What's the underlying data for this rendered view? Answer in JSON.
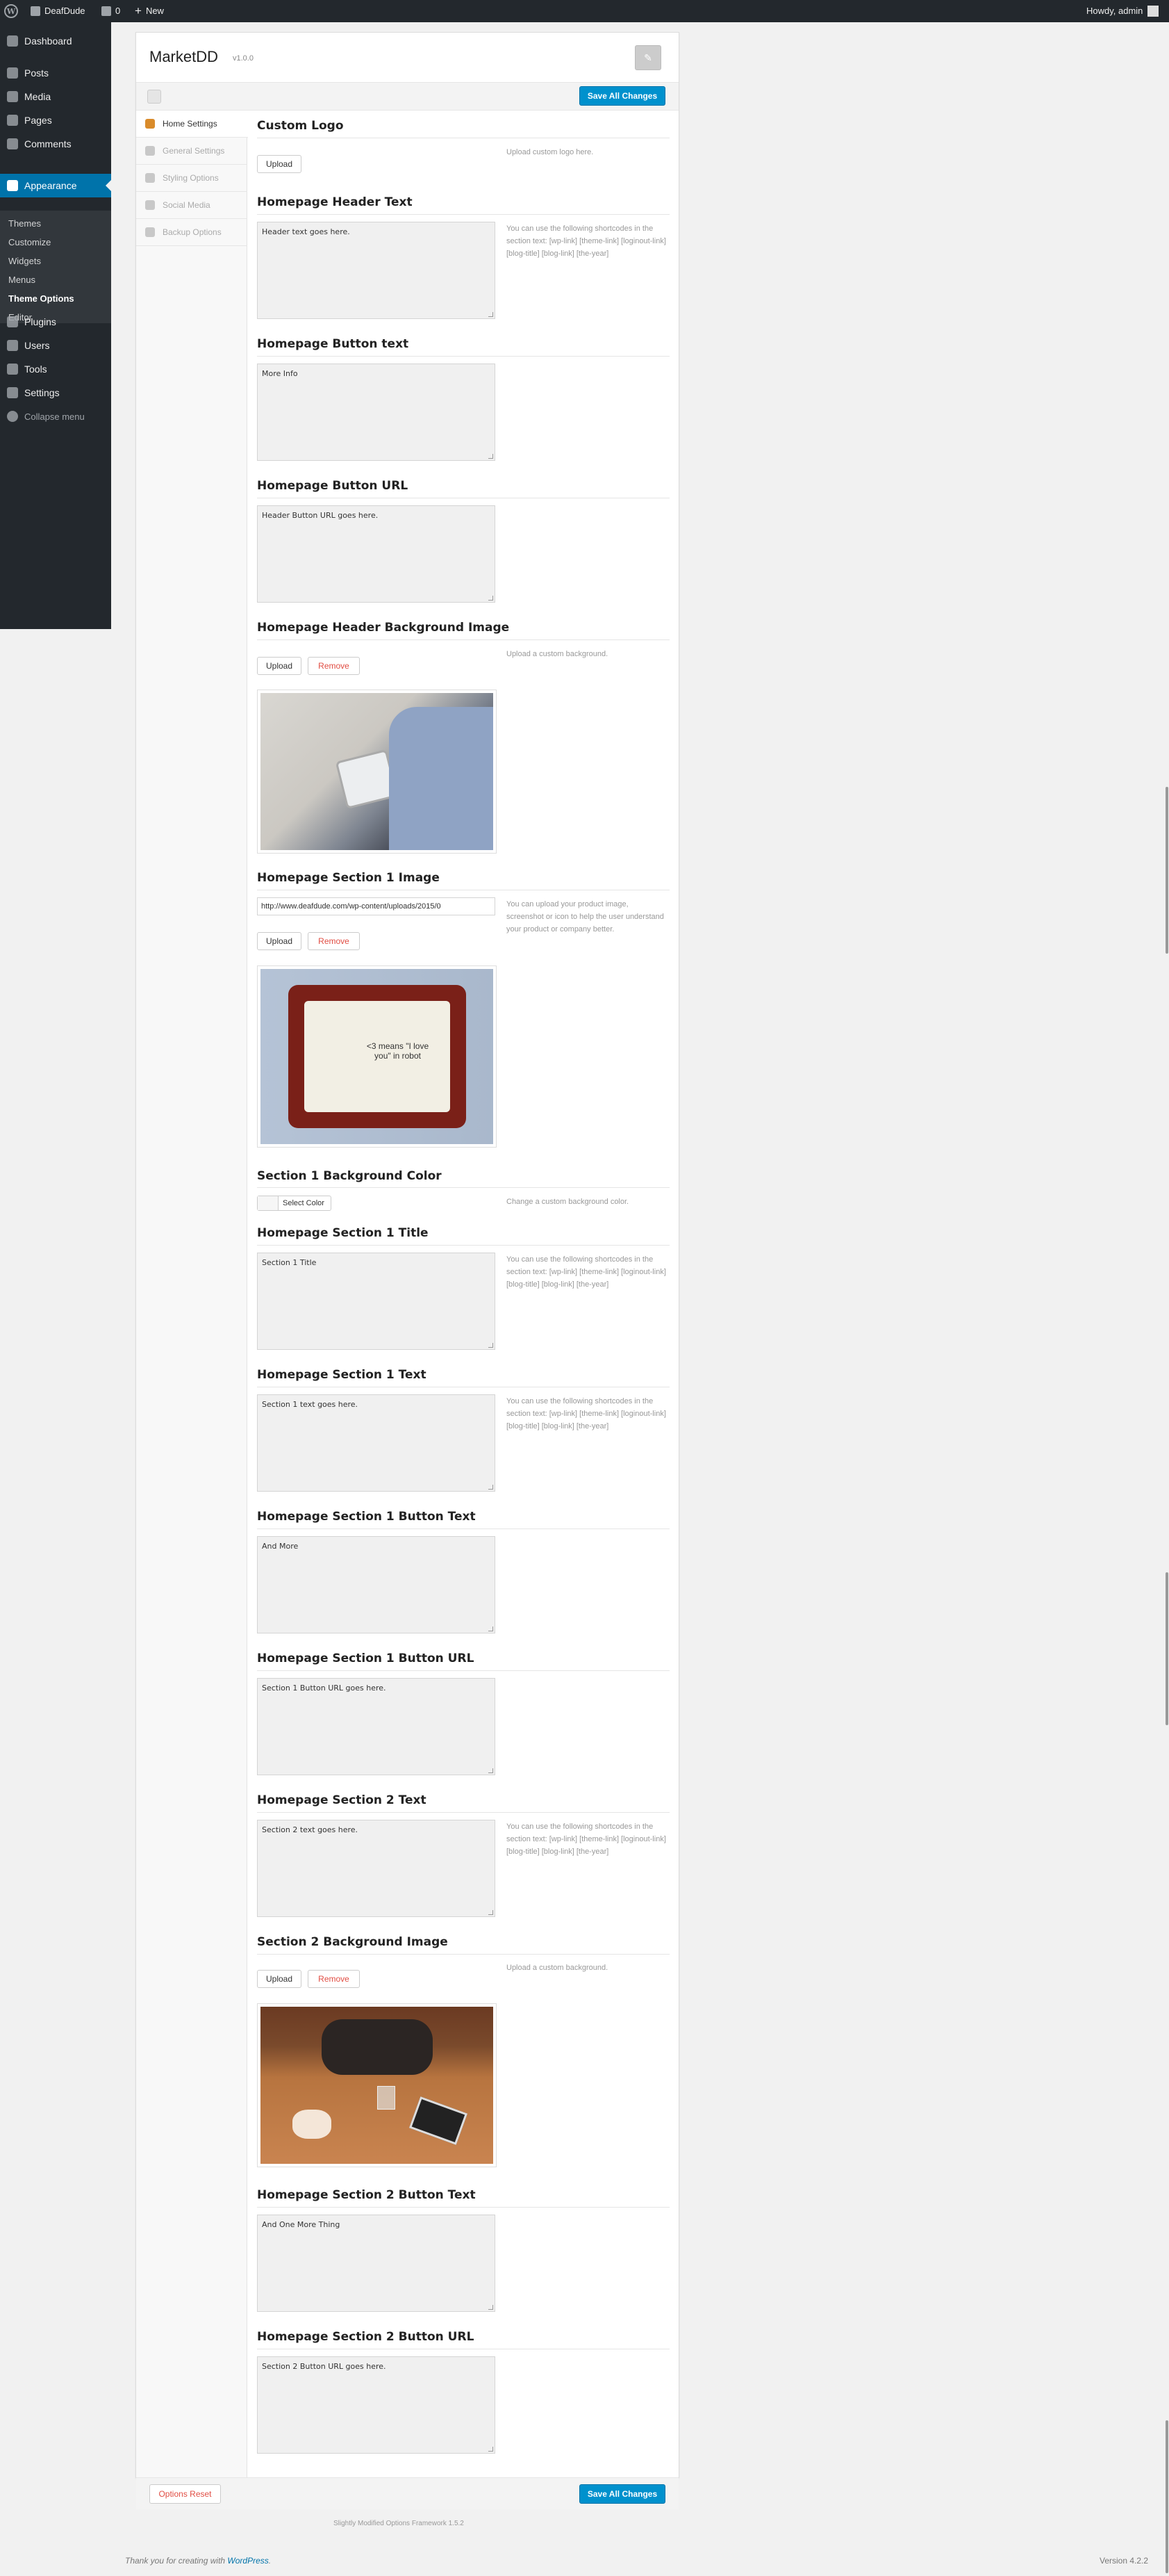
{
  "admin_bar": {
    "site_name": "DeafDude",
    "comments_count": "0",
    "new_label": "New",
    "greeting": "Howdy, admin"
  },
  "menu": {
    "dashboard": "Dashboard",
    "posts": "Posts",
    "media": "Media",
    "pages": "Pages",
    "comments": "Comments",
    "appearance": "Appearance",
    "plugins": "Plugins",
    "users": "Users",
    "tools": "Tools",
    "settings": "Settings",
    "collapse": "Collapse menu"
  },
  "submenu": [
    "Themes",
    "Customize",
    "Widgets",
    "Menus",
    "Theme Options",
    "Editor"
  ],
  "panel": {
    "title": "MarketDD",
    "version": "v1.0.0",
    "save_all": "Save All Changes",
    "options_reset": "Options Reset"
  },
  "tabs": [
    "Home Settings",
    "General Settings",
    "Styling Options",
    "Social Media",
    "Backup Options"
  ],
  "fields": {
    "custom_logo": {
      "label": "Custom Logo",
      "desc": "Upload custom logo here."
    },
    "header_text": {
      "label": "Homepage Header Text",
      "value": "Header text goes here.",
      "desc": "You can use the following shortcodes in the section text: [wp-link] [theme-link] [loginout-link] [blog-title] [blog-link] [the-year]"
    },
    "button_text": {
      "label": "Homepage Button text",
      "value": "More Info"
    },
    "button_url": {
      "label": "Homepage Button URL",
      "value": "Header Button URL goes here."
    },
    "header_bg": {
      "label": "Homepage Header Background Image",
      "desc": "Upload a custom background."
    },
    "section1_image": {
      "label": "Homepage Section 1 Image",
      "value": "http://www.deafdude.com/wp-content/uploads/2015/0",
      "desc": "You can upload your product image, screenshot or icon to help the user understand your product or company better."
    },
    "section1_bg_color": {
      "label": "Section 1 Background Color",
      "button": "Select Color",
      "desc": "Change a custom background color."
    },
    "section1_title": {
      "label": "Homepage Section 1 Title",
      "value": "Section 1 Title",
      "desc": "You can use the following shortcodes in the section text: [wp-link] [theme-link] [loginout-link] [blog-title] [blog-link] [the-year]"
    },
    "section1_text": {
      "label": "Homepage Section 1 Text",
      "value": "Section 1 text goes here.",
      "desc": "You can use the following shortcodes in the section text: [wp-link] [theme-link] [loginout-link] [blog-title] [blog-link] [the-year]"
    },
    "section1_button_text": {
      "label": "Homepage Section 1 Button Text",
      "value": "And More"
    },
    "section1_button_url": {
      "label": "Homepage Section 1 Button URL",
      "value": "Section 1 Button URL goes here."
    },
    "section2_text": {
      "label": "Homepage Section 2 Text",
      "value": "Section 2 text goes here.",
      "desc": "You can use the following shortcodes in the section text: [wp-link] [theme-link] [loginout-link] [blog-title] [blog-link] [the-year]"
    },
    "section2_bg": {
      "label": "Section 2 Background Image",
      "desc": "Upload a custom background."
    },
    "section2_button_text": {
      "label": "Homepage Section 2 Button Text",
      "value": "And One More Thing"
    },
    "section2_button_url": {
      "label": "Homepage Section 2 Button URL",
      "value": "Section 2 Button URL goes here."
    }
  },
  "buttons": {
    "upload": "Upload",
    "remove": "Remove"
  },
  "picture_text": {
    "cross_stitch": "<3 means \"I love you\" in robot"
  },
  "footer": {
    "framework": "Slightly Modified Options Framework 1.5.2",
    "thanks_prefix": "Thank you for creating with ",
    "thanks_link": "WordPress",
    "thanks_suffix": ".",
    "version": "Version 4.2.2"
  }
}
